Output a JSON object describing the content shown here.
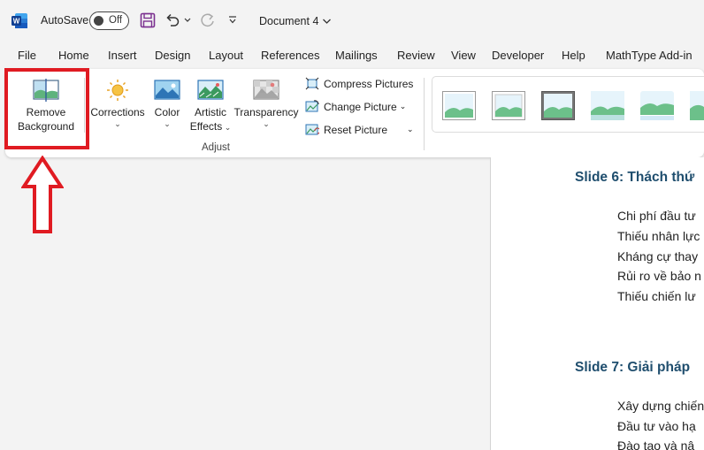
{
  "titlebar": {
    "autosave_label": "AutoSave",
    "autosave_state": "Off",
    "document_title": "Document 4",
    "icons": [
      "word-logo",
      "save-icon",
      "undo-icon",
      "redo-icon",
      "customize-toolbar-icon"
    ]
  },
  "menu": {
    "items": [
      "File",
      "Home",
      "Insert",
      "Design",
      "Layout",
      "References",
      "Mailings",
      "Review",
      "View",
      "Developer",
      "Help",
      "MathType Add-in"
    ]
  },
  "ribbon": {
    "remove_bg": {
      "line1": "Remove",
      "line2": "Background"
    },
    "corrections": "Corrections",
    "color": "Color",
    "artistic": {
      "line1": "Artistic",
      "line2": "Effects"
    },
    "transparency": "Transparency",
    "compress": "Compress Pictures",
    "change": "Change Picture",
    "reset": "Reset Picture",
    "group_label": "Adjust"
  },
  "document": {
    "slide6_title": "Slide 6: Thách thứ",
    "slide6_lines": [
      "Chi phí đầu tư",
      "Thiếu nhân lực",
      "Kháng cự thay",
      "Rủi ro về bảo n",
      "Thiếu chiến lư"
    ],
    "slide7_title": "Slide 7: Giải pháp",
    "slide7_lines": [
      "Xây dựng chiến",
      "Đầu tư vào hạ",
      "Đào tạo và nâ"
    ]
  },
  "colors": {
    "accent_red": "#e01b22",
    "word_blue": "#185abd",
    "heading": "#1f4e6e"
  }
}
